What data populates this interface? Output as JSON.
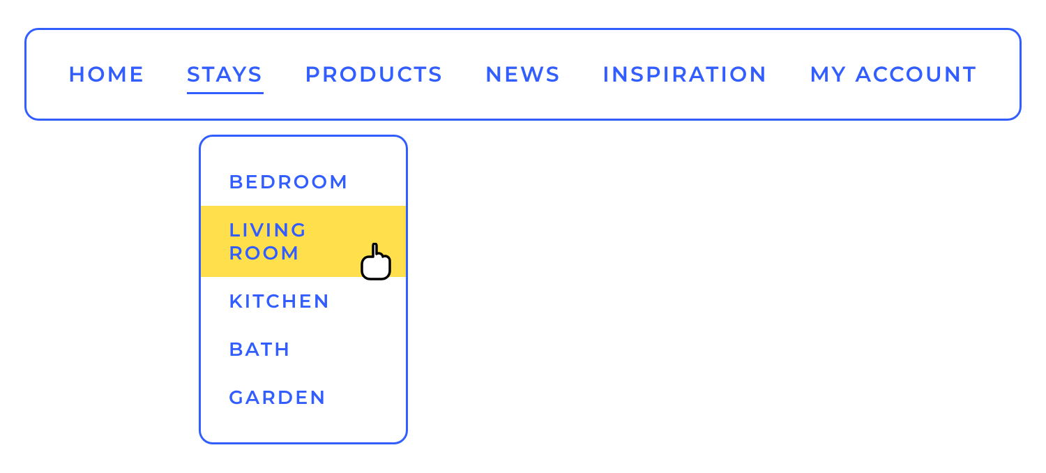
{
  "nav": {
    "items": [
      {
        "label": "HOME",
        "active": false
      },
      {
        "label": "STAYS",
        "active": true
      },
      {
        "label": "PRODUCTS",
        "active": false
      },
      {
        "label": "NEWS",
        "active": false
      },
      {
        "label": "INSPIRATION",
        "active": false
      },
      {
        "label": "MY ACCOUNT",
        "active": false
      }
    ]
  },
  "dropdown": {
    "items": [
      {
        "label": "BEDROOM",
        "highlighted": false
      },
      {
        "label": "LIVING ROOM",
        "highlighted": true
      },
      {
        "label": "KITCHEN",
        "highlighted": false
      },
      {
        "label": "BATH",
        "highlighted": false
      },
      {
        "label": "GARDEN",
        "highlighted": false
      }
    ]
  },
  "colors": {
    "primary": "#335eff",
    "highlight": "#ffdf4c"
  }
}
